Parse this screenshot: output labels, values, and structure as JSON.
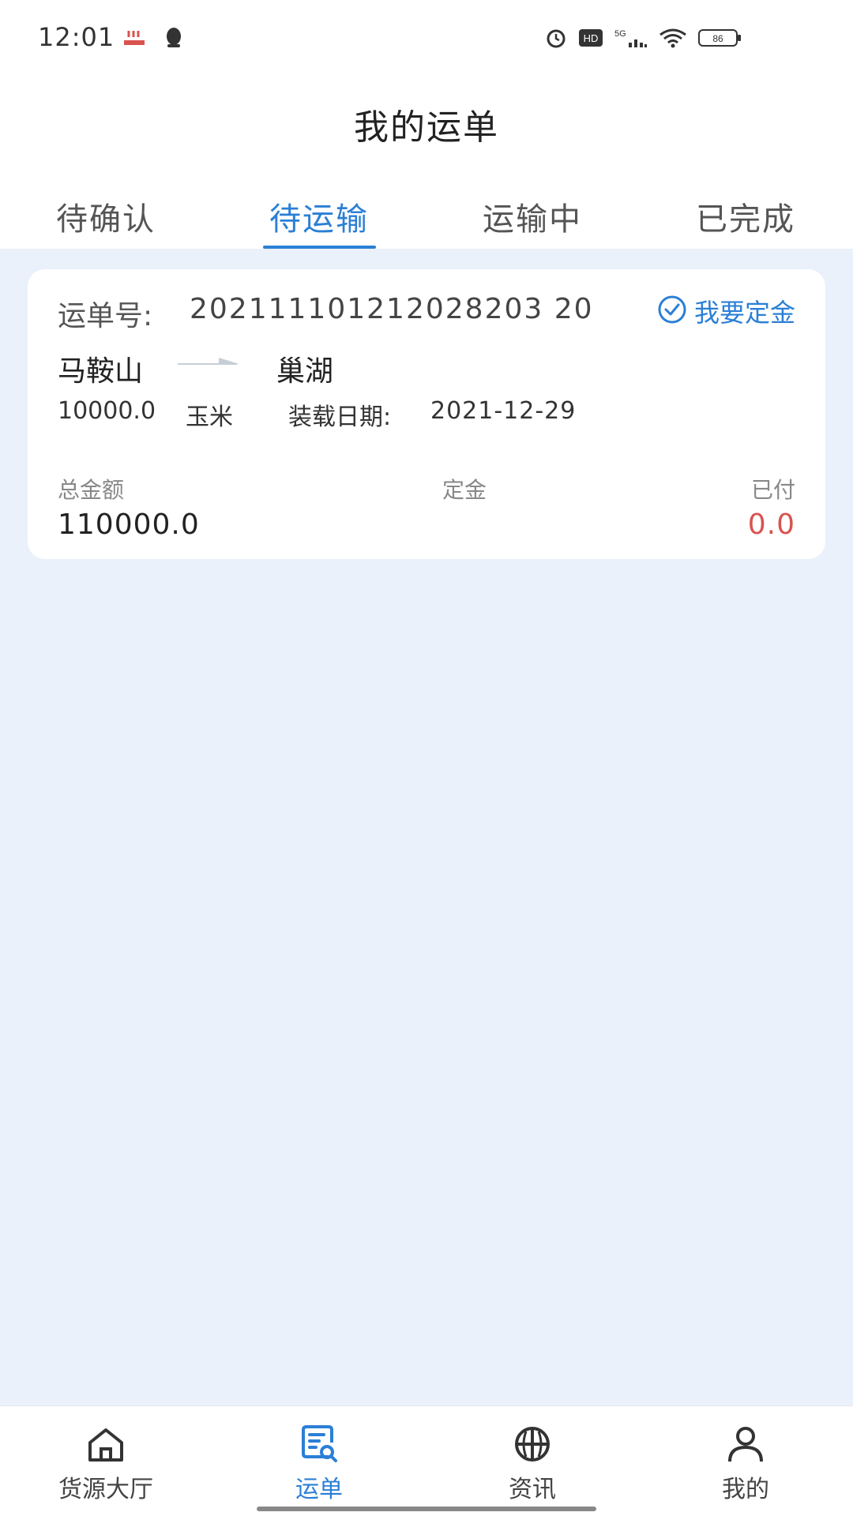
{
  "status_bar": {
    "time": "12:01",
    "battery_text": "86"
  },
  "header": {
    "title": "我的运单"
  },
  "tabs": [
    {
      "label": "待确认",
      "active": false
    },
    {
      "label": "待运输",
      "active": true
    },
    {
      "label": "运输中",
      "active": false
    },
    {
      "label": "已完成",
      "active": false
    }
  ],
  "order": {
    "order_no_label": "运单号:",
    "order_no": "202111101212028203 20",
    "deposit_action_label": "我要定金",
    "route_from": "马鞍山",
    "route_to": "巢湖",
    "cargo_weight": "10000.0",
    "cargo_type": "玉米",
    "load_date_label": "装载日期:",
    "load_date": "2021-12-29",
    "total_amount_label": "总金额",
    "deposit_label": "定金",
    "paid_label": "已付",
    "total_amount": "110000.0",
    "paid_amount": "0.0"
  },
  "bottom_nav": [
    {
      "label": "货源大厅",
      "icon": "home-icon",
      "active": false
    },
    {
      "label": "运单",
      "icon": "waybill-icon",
      "active": true
    },
    {
      "label": "资讯",
      "icon": "news-icon",
      "active": false
    },
    {
      "label": "我的",
      "icon": "profile-icon",
      "active": false
    }
  ],
  "colors": {
    "accent": "#2b7fd6",
    "content_bg": "#eaf1fa",
    "paid_amount": "#d9534f"
  }
}
